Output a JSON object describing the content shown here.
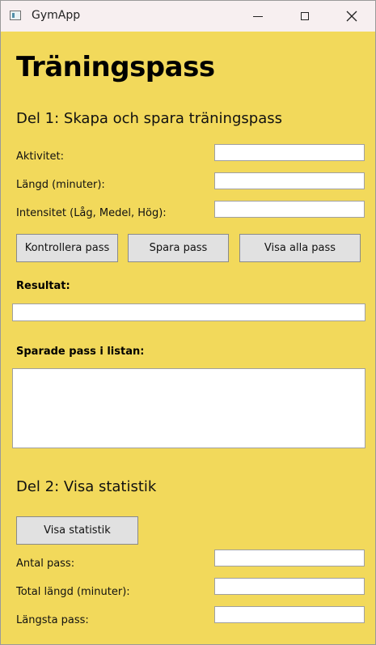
{
  "window": {
    "title": "GymApp",
    "controls": {
      "minimize": "minimize-icon",
      "maximize": "maximize-icon",
      "close": "close-icon"
    }
  },
  "page": {
    "heading": "Träningspass"
  },
  "part1": {
    "heading": "Del 1: Skapa och spara träningspass",
    "fields": [
      {
        "label": "Aktivitet:",
        "value": ""
      },
      {
        "label": "Längd (minuter):",
        "value": ""
      },
      {
        "label": "Intensitet (Låg, Medel, Hög):",
        "value": ""
      }
    ],
    "buttons": {
      "check": "Kontrollera pass",
      "save": "Spara pass",
      "show_all": "Visa alla pass"
    },
    "result_label": "Resultat:",
    "result_value": "",
    "list_label": "Sparade pass i listan:"
  },
  "part2": {
    "heading": "Del 2: Visa statistik",
    "button": "Visa statistik",
    "fields": [
      {
        "label": "Antal pass:",
        "value": ""
      },
      {
        "label": "Total längd (minuter):",
        "value": ""
      },
      {
        "label": "Längsta pass:",
        "value": ""
      }
    ]
  },
  "colors": {
    "background": "#f2d95b",
    "titlebar": "#f7eff0",
    "button": "#e1e1e1"
  }
}
